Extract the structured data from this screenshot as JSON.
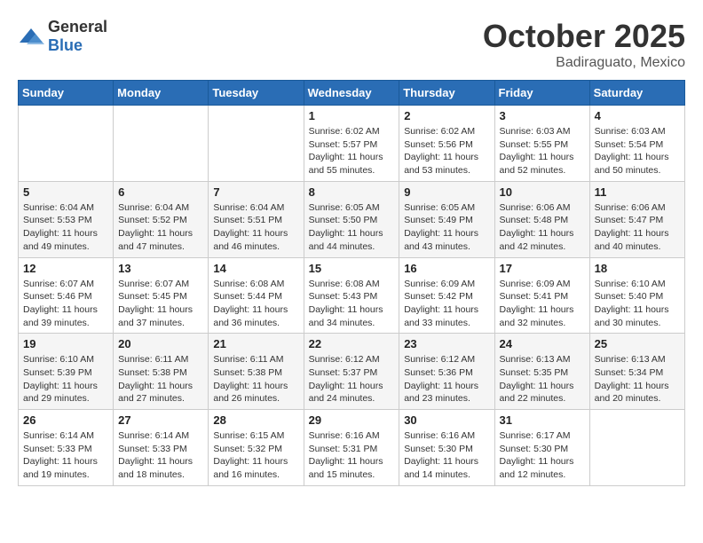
{
  "logo": {
    "text_general": "General",
    "text_blue": "Blue"
  },
  "header": {
    "month": "October 2025",
    "location": "Badiraguato, Mexico"
  },
  "weekdays": [
    "Sunday",
    "Monday",
    "Tuesday",
    "Wednesday",
    "Thursday",
    "Friday",
    "Saturday"
  ],
  "weeks": [
    [
      {
        "day": "",
        "info": ""
      },
      {
        "day": "",
        "info": ""
      },
      {
        "day": "",
        "info": ""
      },
      {
        "day": "1",
        "info": "Sunrise: 6:02 AM\nSunset: 5:57 PM\nDaylight: 11 hours\nand 55 minutes."
      },
      {
        "day": "2",
        "info": "Sunrise: 6:02 AM\nSunset: 5:56 PM\nDaylight: 11 hours\nand 53 minutes."
      },
      {
        "day": "3",
        "info": "Sunrise: 6:03 AM\nSunset: 5:55 PM\nDaylight: 11 hours\nand 52 minutes."
      },
      {
        "day": "4",
        "info": "Sunrise: 6:03 AM\nSunset: 5:54 PM\nDaylight: 11 hours\nand 50 minutes."
      }
    ],
    [
      {
        "day": "5",
        "info": "Sunrise: 6:04 AM\nSunset: 5:53 PM\nDaylight: 11 hours\nand 49 minutes."
      },
      {
        "day": "6",
        "info": "Sunrise: 6:04 AM\nSunset: 5:52 PM\nDaylight: 11 hours\nand 47 minutes."
      },
      {
        "day": "7",
        "info": "Sunrise: 6:04 AM\nSunset: 5:51 PM\nDaylight: 11 hours\nand 46 minutes."
      },
      {
        "day": "8",
        "info": "Sunrise: 6:05 AM\nSunset: 5:50 PM\nDaylight: 11 hours\nand 44 minutes."
      },
      {
        "day": "9",
        "info": "Sunrise: 6:05 AM\nSunset: 5:49 PM\nDaylight: 11 hours\nand 43 minutes."
      },
      {
        "day": "10",
        "info": "Sunrise: 6:06 AM\nSunset: 5:48 PM\nDaylight: 11 hours\nand 42 minutes."
      },
      {
        "day": "11",
        "info": "Sunrise: 6:06 AM\nSunset: 5:47 PM\nDaylight: 11 hours\nand 40 minutes."
      }
    ],
    [
      {
        "day": "12",
        "info": "Sunrise: 6:07 AM\nSunset: 5:46 PM\nDaylight: 11 hours\nand 39 minutes."
      },
      {
        "day": "13",
        "info": "Sunrise: 6:07 AM\nSunset: 5:45 PM\nDaylight: 11 hours\nand 37 minutes."
      },
      {
        "day": "14",
        "info": "Sunrise: 6:08 AM\nSunset: 5:44 PM\nDaylight: 11 hours\nand 36 minutes."
      },
      {
        "day": "15",
        "info": "Sunrise: 6:08 AM\nSunset: 5:43 PM\nDaylight: 11 hours\nand 34 minutes."
      },
      {
        "day": "16",
        "info": "Sunrise: 6:09 AM\nSunset: 5:42 PM\nDaylight: 11 hours\nand 33 minutes."
      },
      {
        "day": "17",
        "info": "Sunrise: 6:09 AM\nSunset: 5:41 PM\nDaylight: 11 hours\nand 32 minutes."
      },
      {
        "day": "18",
        "info": "Sunrise: 6:10 AM\nSunset: 5:40 PM\nDaylight: 11 hours\nand 30 minutes."
      }
    ],
    [
      {
        "day": "19",
        "info": "Sunrise: 6:10 AM\nSunset: 5:39 PM\nDaylight: 11 hours\nand 29 minutes."
      },
      {
        "day": "20",
        "info": "Sunrise: 6:11 AM\nSunset: 5:38 PM\nDaylight: 11 hours\nand 27 minutes."
      },
      {
        "day": "21",
        "info": "Sunrise: 6:11 AM\nSunset: 5:38 PM\nDaylight: 11 hours\nand 26 minutes."
      },
      {
        "day": "22",
        "info": "Sunrise: 6:12 AM\nSunset: 5:37 PM\nDaylight: 11 hours\nand 24 minutes."
      },
      {
        "day": "23",
        "info": "Sunrise: 6:12 AM\nSunset: 5:36 PM\nDaylight: 11 hours\nand 23 minutes."
      },
      {
        "day": "24",
        "info": "Sunrise: 6:13 AM\nSunset: 5:35 PM\nDaylight: 11 hours\nand 22 minutes."
      },
      {
        "day": "25",
        "info": "Sunrise: 6:13 AM\nSunset: 5:34 PM\nDaylight: 11 hours\nand 20 minutes."
      }
    ],
    [
      {
        "day": "26",
        "info": "Sunrise: 6:14 AM\nSunset: 5:33 PM\nDaylight: 11 hours\nand 19 minutes."
      },
      {
        "day": "27",
        "info": "Sunrise: 6:14 AM\nSunset: 5:33 PM\nDaylight: 11 hours\nand 18 minutes."
      },
      {
        "day": "28",
        "info": "Sunrise: 6:15 AM\nSunset: 5:32 PM\nDaylight: 11 hours\nand 16 minutes."
      },
      {
        "day": "29",
        "info": "Sunrise: 6:16 AM\nSunset: 5:31 PM\nDaylight: 11 hours\nand 15 minutes."
      },
      {
        "day": "30",
        "info": "Sunrise: 6:16 AM\nSunset: 5:30 PM\nDaylight: 11 hours\nand 14 minutes."
      },
      {
        "day": "31",
        "info": "Sunrise: 6:17 AM\nSunset: 5:30 PM\nDaylight: 11 hours\nand 12 minutes."
      },
      {
        "day": "",
        "info": ""
      }
    ]
  ]
}
